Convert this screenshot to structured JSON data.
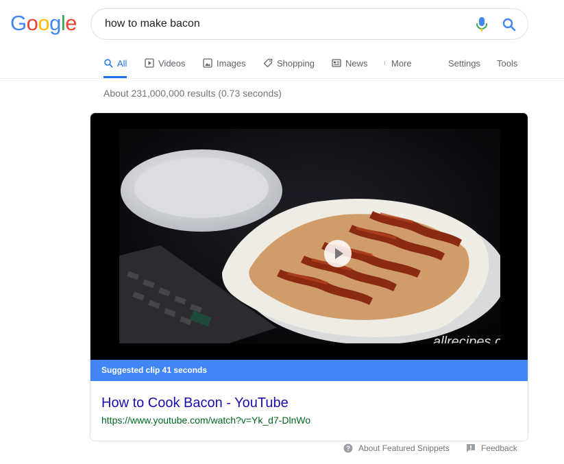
{
  "logo": {
    "letters": [
      "G",
      "o",
      "o",
      "g",
      "l",
      "e"
    ],
    "colors": [
      "#4285F4",
      "#EA4335",
      "#FBBC05",
      "#4285F4",
      "#34A853",
      "#EA4335"
    ]
  },
  "search": {
    "query": "how to make bacon",
    "mic_icon": "mic-icon",
    "search_icon": "search-icon"
  },
  "tabs": [
    {
      "label": "All",
      "icon": "search-icon",
      "active": true
    },
    {
      "label": "Videos",
      "icon": "play-square-icon"
    },
    {
      "label": "Images",
      "icon": "image-icon"
    },
    {
      "label": "Shopping",
      "icon": "tag-icon"
    },
    {
      "label": "News",
      "icon": "newspaper-icon"
    },
    {
      "label": "More",
      "icon": "more-vert-icon"
    },
    {
      "label": "Settings"
    },
    {
      "label": "Tools"
    }
  ],
  "stats": "About 231,000,000 results (0.73 seconds)",
  "featured": {
    "watermark": "allrecipes.com",
    "clip_label": "Suggested clip 41 seconds",
    "title": "How to Cook Bacon - YouTube",
    "url": "https://www.youtube.com/watch?v=Yk_d7-DlnWo"
  },
  "footer": {
    "about": "About Featured Snippets",
    "feedback": "Feedback"
  },
  "colors": {
    "accent": "#1a73e8",
    "link": "#1a0dab",
    "url": "#006621",
    "clip_bar": "#4285f4"
  }
}
